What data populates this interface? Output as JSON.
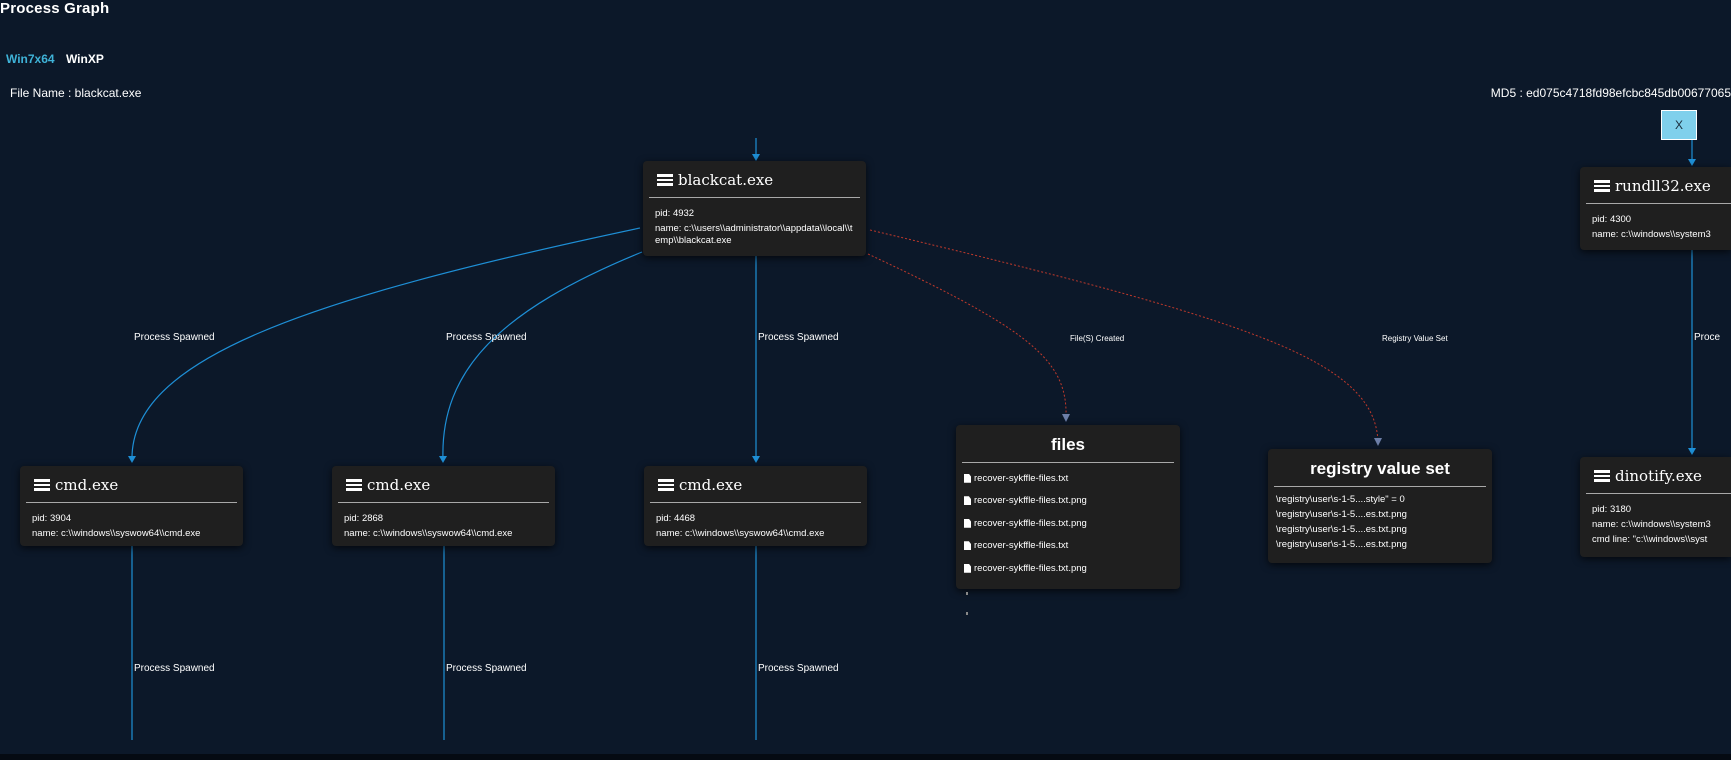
{
  "page": {
    "title": "Process Graph",
    "tabs": [
      "Win7x64",
      "WinXP"
    ],
    "file_name": "File Name : blackcat.exe",
    "md5": "MD5 : ed075c4718fd98efcbc845db00677065",
    "close_label": "X"
  },
  "edges": {
    "process_spawned": "Process Spawned",
    "files_created": "File(S) Created",
    "registry_value_set": "Registry Value Set",
    "proce_truncated": "Proce"
  },
  "nodes": {
    "blackcat": {
      "title": "blackcat.exe",
      "pid": "pid: 4932",
      "name": "name: c:\\\\users\\\\administrator\\\\appdata\\\\local\\\\temp\\\\blackcat.exe"
    },
    "cmd1": {
      "title": "cmd.exe",
      "pid": "pid: 3904",
      "name": "name: c:\\\\windows\\\\syswow64\\\\cmd.exe"
    },
    "cmd2": {
      "title": "cmd.exe",
      "pid": "pid: 2868",
      "name": "name: c:\\\\windows\\\\syswow64\\\\cmd.exe"
    },
    "cmd3": {
      "title": "cmd.exe",
      "pid": "pid: 4468",
      "name": "name: c:\\\\windows\\\\syswow64\\\\cmd.exe"
    },
    "rundll": {
      "title": "rundll32.exe",
      "pid": "pid: 4300",
      "name": "name: c:\\\\windows\\\\system3"
    },
    "dinotify": {
      "title": "dinotify.exe",
      "pid": "pid: 3180",
      "name": "name: c:\\\\windows\\\\system3",
      "cmd": "cmd line: \"c:\\\\windows\\\\syst"
    }
  },
  "files": {
    "title": "files",
    "items": [
      "recover-sykffle-files.txt",
      "recover-sykffle-files.txt.png",
      "recover-sykffle-files.txt.png",
      "recover-sykffle-files.txt",
      "recover-sykffle-files.txt.png"
    ]
  },
  "registry": {
    "title": "registry value set",
    "items": [
      "\\registry\\user\\s-1-5....style\" = 0",
      "\\registry\\user\\s-1-5....es.txt.png",
      "\\registry\\user\\s-1-5....es.txt.png",
      "\\registry\\user\\s-1-5....es.txt.png"
    ]
  },
  "colors": {
    "background": "#0c1829",
    "edge_blue": "#1e8fd6",
    "edge_red": "#c0392b",
    "tab_active": "#3fb3d8",
    "node_bg": "#1f1f1f",
    "close_btn": "#7fd0ec"
  }
}
